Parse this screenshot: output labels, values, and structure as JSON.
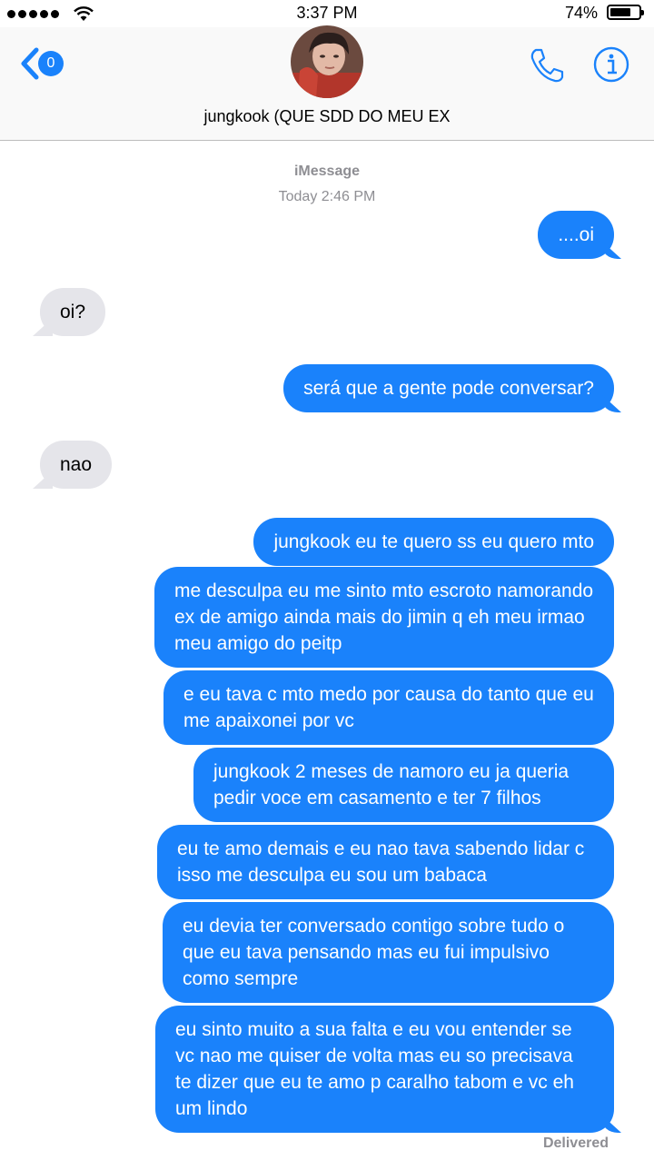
{
  "status_bar": {
    "time": "3:37 PM",
    "battery_percent": "74%",
    "battery_level": 0.74,
    "signal_dots": 5
  },
  "header": {
    "back_badge": "0",
    "contact_name": "jungkook (QUE SDD DO MEU EX",
    "icons": [
      "back-chevron-icon",
      "phone-icon",
      "info-icon"
    ],
    "accent_color": "#1a82fb"
  },
  "conversation": {
    "service": "iMessage",
    "timestamp": "Today 2:46 PM",
    "messages": [
      {
        "from": "me",
        "text": "....oi"
      },
      {
        "from": "them",
        "text": "oi?"
      },
      {
        "from": "me",
        "text": "será que a gente pode conversar?"
      },
      {
        "from": "them",
        "text": "nao"
      },
      {
        "from": "me",
        "text": "jungkook eu te quero ss eu quero mto"
      },
      {
        "from": "me",
        "text": "me desculpa eu me sinto mto escroto namorando ex  de amigo ainda mais do jimin q eh meu irmao meu amigo do peitp"
      },
      {
        "from": "me",
        "text": "e eu tava c mto medo por causa do tanto que eu  me apaixonei por vc"
      },
      {
        "from": "me",
        "text": "jungkook 2 meses de namoro eu ja queria pedir voce em casamento e ter 7 filhos"
      },
      {
        "from": "me",
        "text": "eu te amo demais e eu nao tava sabendo lidar c isso me desculpa eu sou um babaca"
      },
      {
        "from": "me",
        "text": "eu devia ter conversado contigo sobre tudo o que eu tava pensando mas eu fui impulsivo como sempre"
      },
      {
        "from": "me",
        "text": "eu sinto muito a sua falta e eu vou entender se vc nao me quiser de volta mas eu so precisava te dizer que eu te amo p caralho tabom e vc eh um lindo"
      }
    ],
    "delivery_status": "Delivered"
  }
}
